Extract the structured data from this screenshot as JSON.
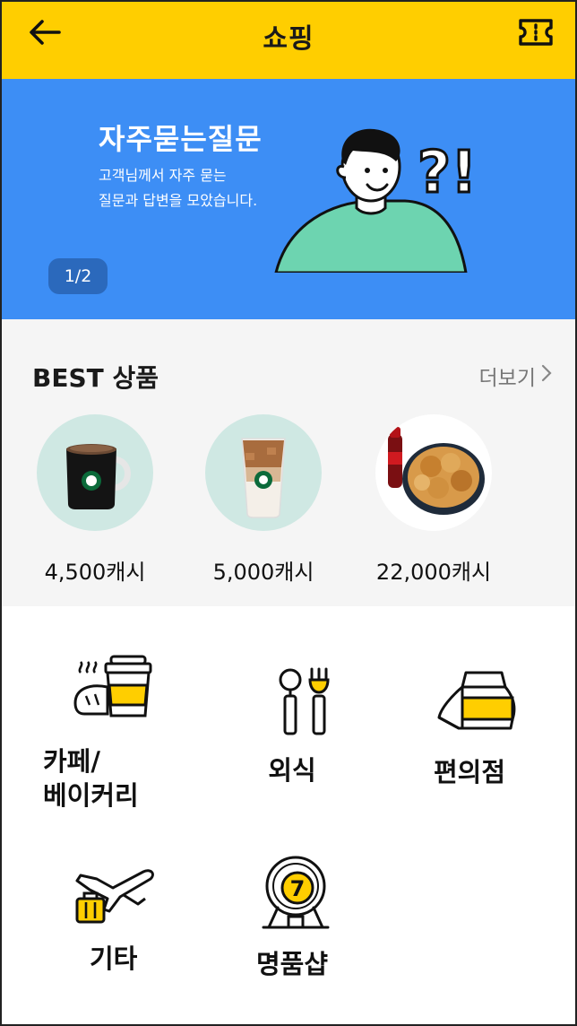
{
  "header": {
    "title": "쇼핑",
    "back_icon": "arrow-left-icon",
    "right_icon": "ticket-icon",
    "background": "#FFCE00"
  },
  "banner": {
    "title": "자주묻는질문",
    "subtitle_line1": "고객님께서 자주 묻는",
    "subtitle_line2": "질문과 답변을 모았습니다.",
    "art_text": "?!",
    "page_indicator": "1/2",
    "background": "#3D8EF5"
  },
  "best": {
    "title": "BEST 상품",
    "more_label": "더보기",
    "more_icon": "chevron-right-icon",
    "products": [
      {
        "price": "4,500캐시",
        "image": "coffee-mug-image"
      },
      {
        "price": "5,000캐시",
        "image": "iced-latte-image"
      },
      {
        "price": "22,000캐시",
        "image": "fried-chicken-cola-image"
      }
    ]
  },
  "categories": [
    {
      "label_line1": "카페/",
      "label_line2": "베이커리",
      "icon": "cafe-bakery-icon"
    },
    {
      "label_line1": "외식",
      "label_line2": "",
      "icon": "spoon-fork-icon"
    },
    {
      "label_line1": "편의점",
      "label_line2": "",
      "icon": "convenience-store-icon"
    },
    {
      "label_line1": "기타",
      "label_line2": "",
      "icon": "airplane-luggage-icon"
    },
    {
      "label_line1": "명품샵",
      "label_line2": "",
      "icon": "lottery-machine-icon",
      "badge": "7"
    }
  ],
  "colors": {
    "accent_yellow": "#FFCE00",
    "banner_blue": "#3D8EF5",
    "product_circle": "#CFE8E3"
  }
}
